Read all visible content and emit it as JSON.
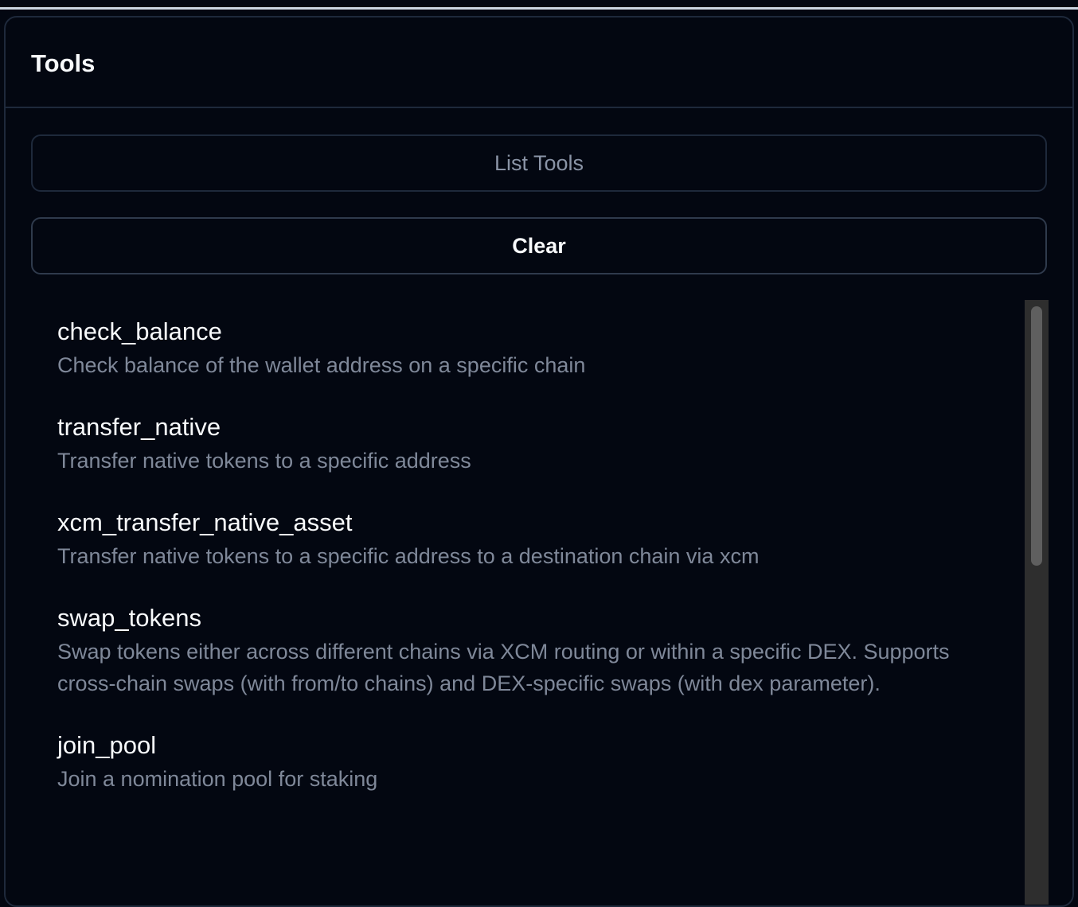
{
  "panel": {
    "title": "Tools",
    "list_tools_label": "List Tools",
    "clear_label": "Clear"
  },
  "tools": [
    {
      "name": "check_balance",
      "description": "Check balance of the wallet address on a specific chain"
    },
    {
      "name": "transfer_native",
      "description": "Transfer native tokens to a specific address"
    },
    {
      "name": "xcm_transfer_native_asset",
      "description": "Transfer native tokens to a specific address to a destination chain via xcm"
    },
    {
      "name": "swap_tokens",
      "description": "Swap tokens either across different chains via XCM routing or within a specific DEX. Supports cross-chain swaps (with from/to chains) and DEX-specific swaps (with dex parameter)."
    },
    {
      "name": "join_pool",
      "description": "Join a nomination pool for staking"
    }
  ],
  "colors": {
    "background": "#030711",
    "border": "#1e293b",
    "text_primary": "#f8fafc",
    "text_muted": "#7f8899",
    "disabled_button_text": "#8a94a6"
  }
}
